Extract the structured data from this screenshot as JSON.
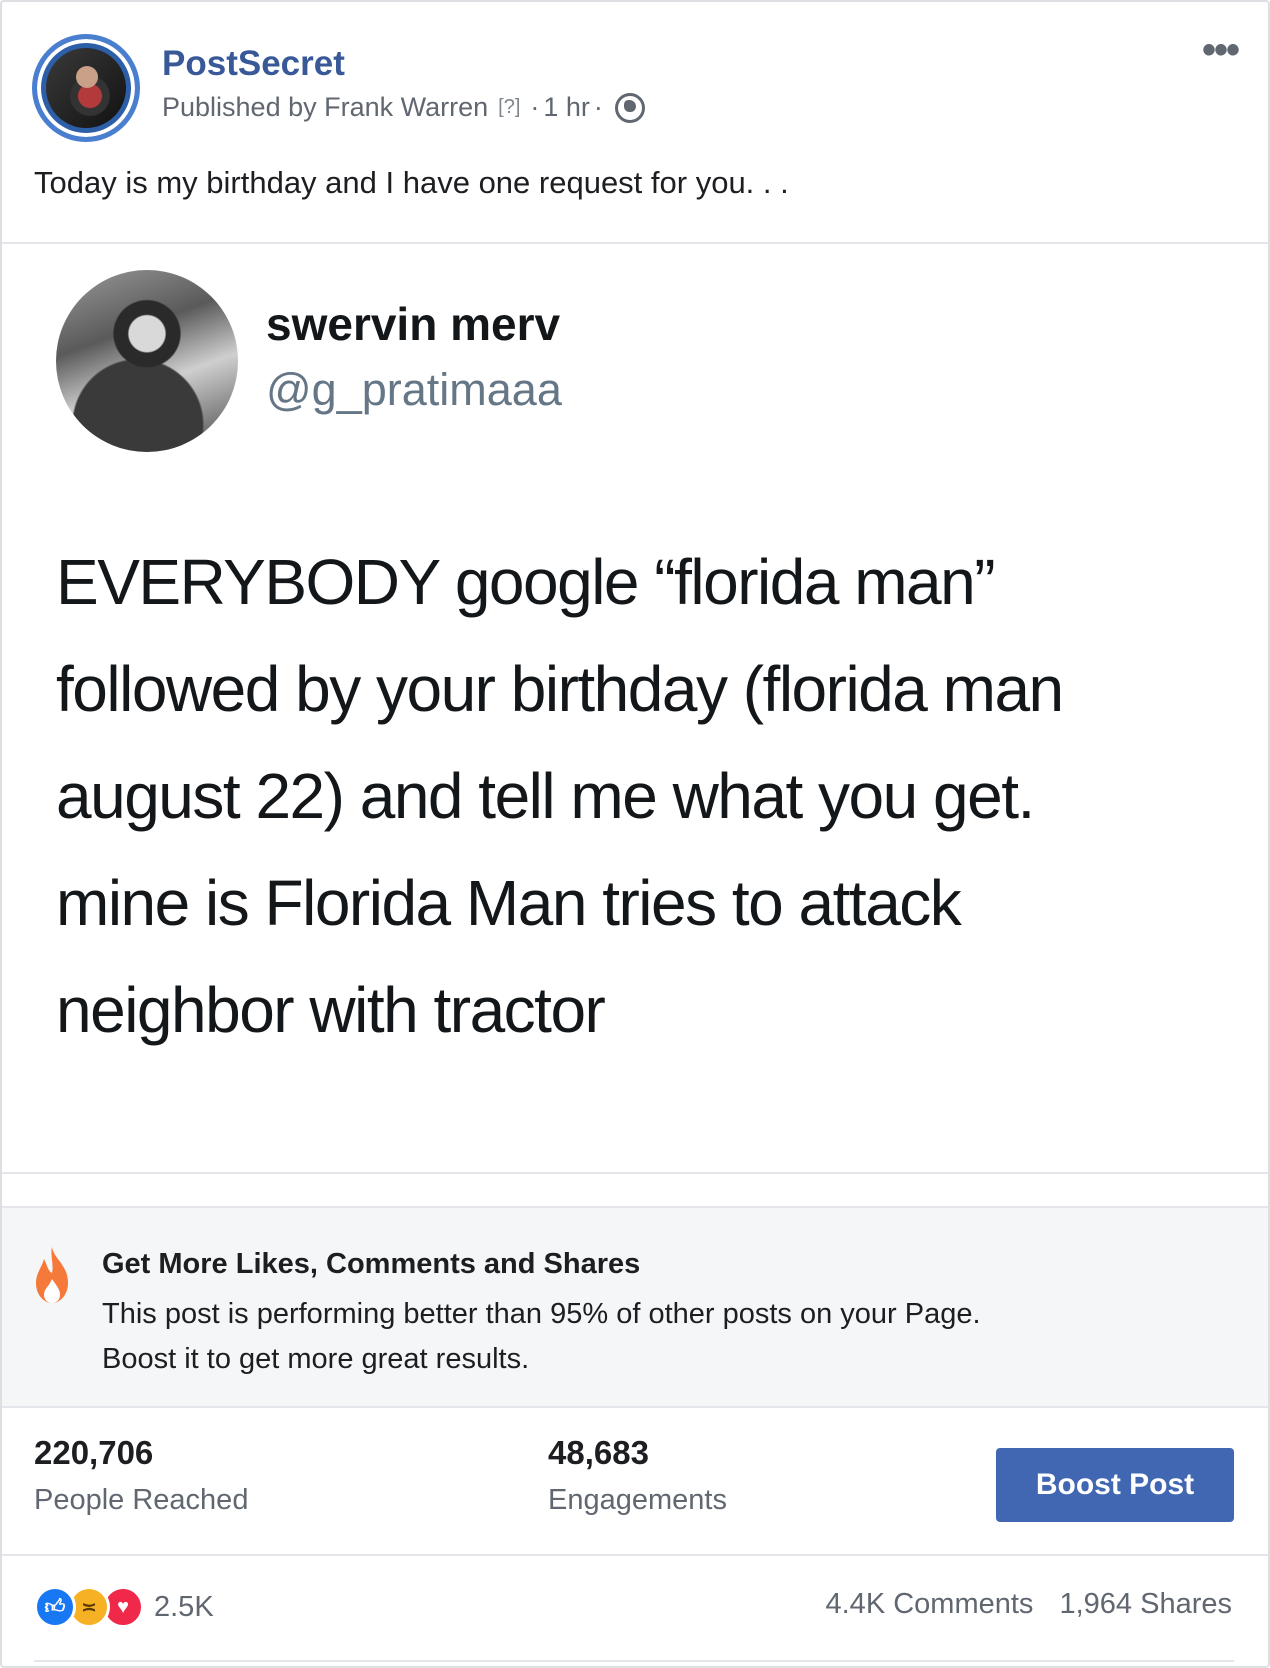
{
  "post": {
    "page_name": "PostSecret",
    "published_by": "Published by Frank Warren",
    "help_marker": "[?]",
    "time": "1 hr",
    "caption": "Today is my birthday and I have one request for you. . ."
  },
  "tweet": {
    "name": "swervin merv",
    "handle": "@g_pratimaaa",
    "lines": [
      "EVERYBODY google “florida man”",
      "followed by your birthday (florida man",
      "august 22) and tell me what you get.",
      "mine is Florida Man tries to attack",
      "neighbor with tractor"
    ]
  },
  "boost_prompt": {
    "title": "Get More Likes, Comments and Shares",
    "body_line1": "This post is performing better than 95% of other posts on your Page.",
    "body_line2": "Boost it to get more great results."
  },
  "stats": {
    "reached_value": "220,706",
    "reached_label": "People Reached",
    "engagements_value": "48,683",
    "engagements_label": "Engagements",
    "boost_button": "Boost Post"
  },
  "footer": {
    "reactions_count": "2.5K",
    "comments": "4.4K Comments",
    "shares": "1,964 Shares"
  },
  "colors": {
    "page_name": "#385898",
    "boost_button": "#4267b2",
    "like": "#1877f2",
    "haha": "#f7b125",
    "love": "#f0284a",
    "fire": "#f5793a"
  },
  "icons": [
    "page-avatar",
    "globe-icon",
    "more-icon",
    "fire-icon",
    "like-icon",
    "haha-icon",
    "love-icon"
  ]
}
